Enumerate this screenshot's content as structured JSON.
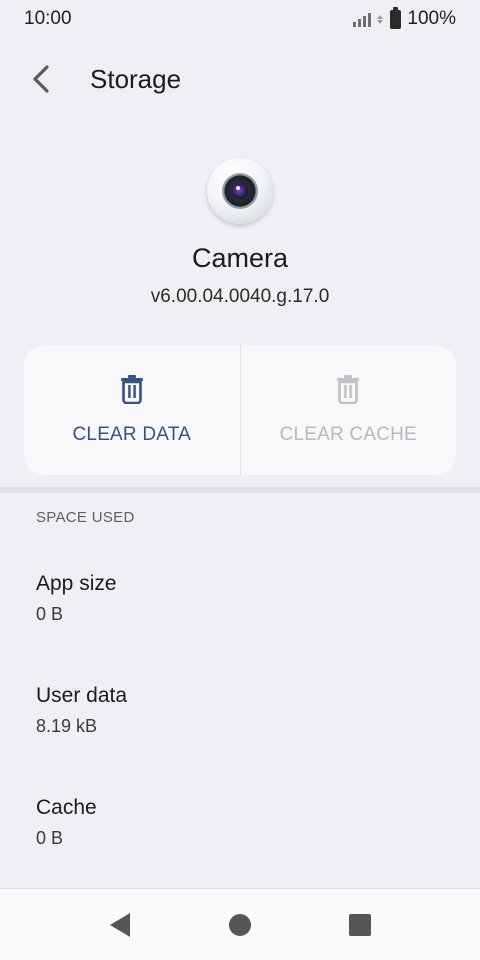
{
  "status_bar": {
    "time": "10:00",
    "battery_text": "100%",
    "icons": [
      "signal-icon",
      "data-activity-icon",
      "battery-icon"
    ]
  },
  "app_bar": {
    "title": "Storage",
    "back_icon": "back-arrow-icon"
  },
  "app_info": {
    "name": "Camera",
    "version": "v6.00.04.0040.g.17.0",
    "icon": "camera-app-icon"
  },
  "actions": {
    "clear_data": {
      "label": "CLEAR DATA",
      "icon": "trash-icon",
      "enabled": true,
      "color": "#365380"
    },
    "clear_cache": {
      "label": "CLEAR CACHE",
      "icon": "trash-icon",
      "enabled": false,
      "color": "#b8b9bd"
    }
  },
  "space_used": {
    "header": "SPACE USED",
    "items": [
      {
        "title": "App size",
        "value": "0 B"
      },
      {
        "title": "User data",
        "value": "8.19 kB"
      },
      {
        "title": "Cache",
        "value": "0 B"
      }
    ]
  },
  "nav_bar": {
    "buttons": [
      "nav-back-icon",
      "nav-home-icon",
      "nav-recents-icon"
    ]
  }
}
